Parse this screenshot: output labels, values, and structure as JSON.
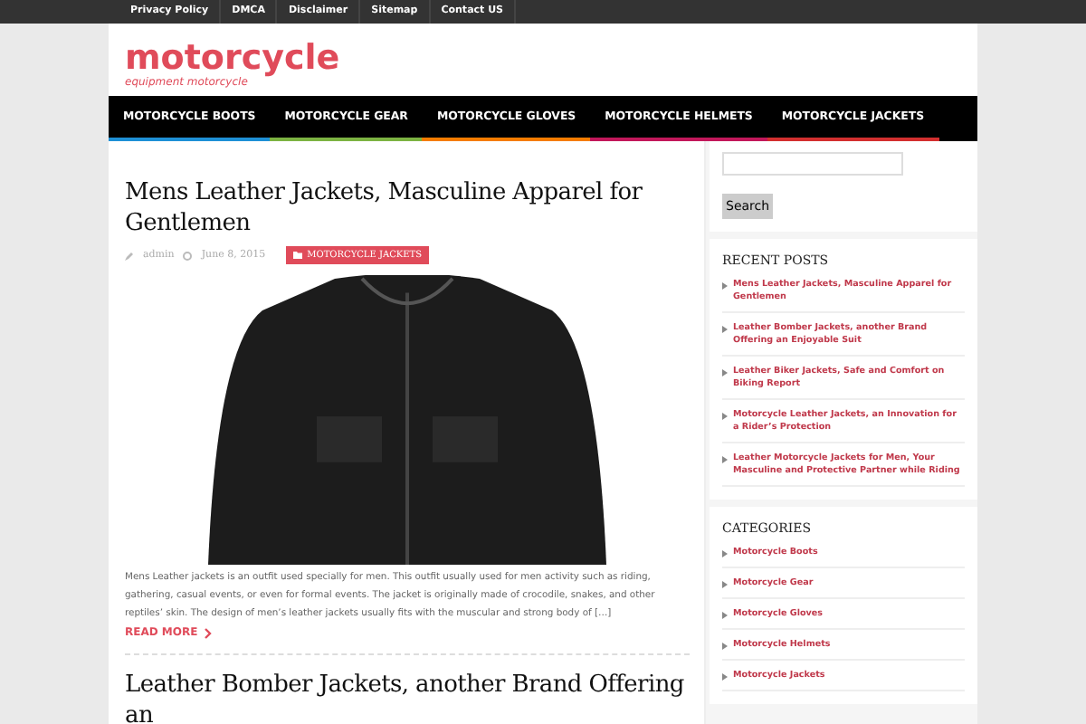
{
  "top_menu": [
    "Privacy Policy",
    "DMCA",
    "Disclaimer",
    "Sitemap",
    "Contact US"
  ],
  "site": {
    "title": "motorcycle",
    "tagline": "equipment motorcycle"
  },
  "nav": [
    {
      "label": "MOTORCYCLE BOOTS",
      "color": "#1e90d6"
    },
    {
      "label": "MOTORCYCLE GEAR",
      "color": "#7cb342"
    },
    {
      "label": "MOTORCYCLE GLOVES",
      "color": "#f57c00"
    },
    {
      "label": "MOTORCYCLE HELMETS",
      "color": "#c2185b"
    },
    {
      "label": "MOTORCYCLE JACKETS",
      "color": "#d32f2f"
    }
  ],
  "posts": [
    {
      "title": "Mens Leather Jackets, Masculine Apparel for Gentlemen",
      "author": "admin",
      "date": "June 8, 2015",
      "category": "MOTORCYCLE JACKETS",
      "excerpt": "Mens Leather jackets is an outfit used specially for men. This outfit usually used for men activity such as riding, gathering, casual events, or even for formal events. The jacket is originally made of crocodile, snakes, and other reptiles’ skin. The design of men’s leather jackets usually fits with the muscular and strong body of […]",
      "read_more": "READ MORE"
    },
    {
      "title": "Leather Bomber Jackets, another Brand Offering an"
    }
  ],
  "sidebar": {
    "search_button": "Search",
    "recent_title": "RECENT POSTS",
    "recent": [
      "Mens Leather Jackets, Masculine Apparel for Gentlemen",
      "Leather Bomber Jackets, another Brand Offering an Enjoyable Suit",
      "Leather Biker Jackets, Safe and Comfort on Biking Report",
      "Motorcycle Leather Jackets, an Innovation for a Rider’s Protection",
      "Leather Motorcycle Jackets for Men, Your Masculine and Protective Partner while Riding"
    ],
    "categories_title": "CATEGORIES",
    "categories": [
      "Motorcycle Boots",
      "Motorcycle Gear",
      "Motorcycle Gloves",
      "Motorcycle Helmets",
      "Motorcycle Jackets"
    ]
  }
}
